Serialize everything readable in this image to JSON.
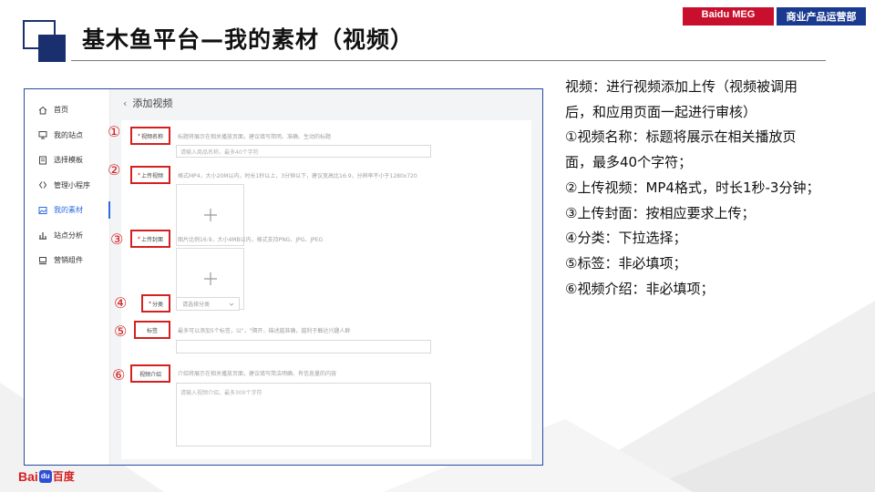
{
  "slide": {
    "title": "基木鱼平台—我的素材（视频）",
    "badges": {
      "brand": "Baidu MEG",
      "dept": "商业产品运营部"
    }
  },
  "app": {
    "page_title": "添加视频",
    "sidebar": [
      {
        "label": "首页",
        "icon": "home-icon"
      },
      {
        "label": "我的站点",
        "icon": "monitor-icon"
      },
      {
        "label": "选择模板",
        "icon": "template-icon"
      },
      {
        "label": "管理小程序",
        "icon": "miniprogram-icon"
      },
      {
        "label": "我的素材",
        "icon": "image-icon",
        "active": true
      },
      {
        "label": "站点分析",
        "icon": "bar-chart-icon"
      },
      {
        "label": "营销组件",
        "icon": "component-icon"
      }
    ],
    "form": {
      "video_name": {
        "label": "视频名称",
        "required": "*",
        "hint": "标题将展示在相关播放页面，建议填写简明、准确、生动的标题",
        "placeholder": "请输入商品名称，最多40个字符"
      },
      "upload_video": {
        "label": "上传视频",
        "required": "*",
        "hint": "格式MP4，大小20M以内，时长1秒以上，3分钟以下，建议宽高比16:9，分辨率不小于1280x720"
      },
      "upload_cover": {
        "label": "上传封面",
        "required": "*",
        "hint": "图片比例16:9，大小4MB以内，格式支持PNG、JPG、JPEG"
      },
      "category": {
        "label": "分类",
        "required": "*",
        "selected": "请选择分类"
      },
      "tags": {
        "label": "标签",
        "hint": "最多可以添加5个标签，以\"，\"隔开，描述越准确，越利于触达兴趣人群"
      },
      "intro": {
        "label": "视频介绍",
        "hint": "介绍将展示在相关播放页面，建议填写简洁明确、有信息量的内容",
        "placeholder": "请输入视频介绍，最多300个字符"
      }
    },
    "markers": [
      "①",
      "②",
      "③",
      "④",
      "⑤",
      "⑥"
    ]
  },
  "description": [
    "视频：进行视频添加上传（视频被调用后，和应用页面一起进行审核）",
    "①视频名称：标题将展示在相关播放页面，最多40个字符；",
    "②上传视频：MP4格式，时长1秒-3分钟；",
    "③上传封面：按相应要求上传；",
    "④分类：下拉选择；",
    "⑤标签：非必填项；",
    "⑥视频介绍：非必填项；"
  ],
  "footer_logo": {
    "bai": "Bai",
    "paw": "du",
    "du": "百度"
  },
  "colors": {
    "accent_red": "#d62020",
    "navy": "#1a2f6e",
    "brand_blue": "#1a3a8f",
    "active_blue": "#2d6cdf"
  }
}
